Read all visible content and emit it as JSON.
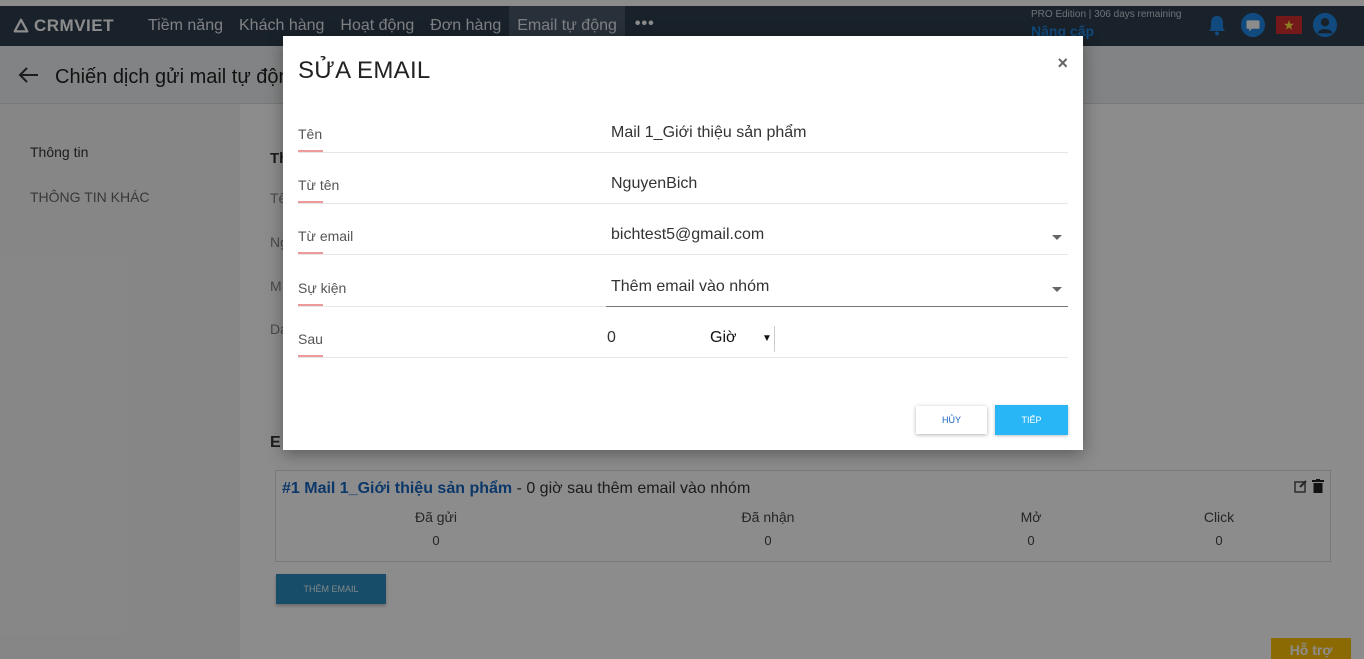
{
  "app": {
    "logo": "CRMVIET",
    "nav": [
      "Tiềm năng",
      "Khách hàng",
      "Hoạt động",
      "Đơn hàng",
      "Email tự động"
    ],
    "nav_more": "•••",
    "edition": "PRO Edition | 306 days remaining",
    "upgrade": "Nâng cấp"
  },
  "header": {
    "title": "Chiến dịch gửi mail tự động"
  },
  "sidebar": {
    "items": [
      "Thông tin",
      "THÔNG TIN KHÁC"
    ]
  },
  "main": {
    "peek_letters": [
      "Th",
      "Tê",
      "Ng",
      "M",
      "Da"
    ],
    "section_peek": "E",
    "mail_card": {
      "link": "#1 Mail 1_Giới thiệu sản phẩm",
      "suffix": " - 0 giờ sau thêm email vào nhóm",
      "stats": [
        {
          "label": "Đã gửi",
          "value": "0"
        },
        {
          "label": "Đã nhận",
          "value": "0"
        },
        {
          "label": "Mở",
          "value": "0"
        },
        {
          "label": "Click",
          "value": "0"
        }
      ]
    },
    "add_email_button": "THÊM EMAIL",
    "support_button": "Hỗ trợ"
  },
  "modal": {
    "title": "SỬA EMAIL",
    "close": "×",
    "fields": {
      "name": {
        "label": "Tên",
        "value": "Mail 1_Giới thiệu sản phẩm"
      },
      "from_name": {
        "label": "Từ tên",
        "value": "NguyenBich"
      },
      "from_email": {
        "label": "Từ email",
        "value": "bichtest5@gmail.com"
      },
      "event": {
        "label": "Sự kiện",
        "value": "Thêm email vào nhóm"
      },
      "after": {
        "label": "Sau",
        "number": "0",
        "unit": "Giờ"
      }
    },
    "cancel_label": "HỦY",
    "next_label": "TIẾP"
  },
  "colors": {
    "navbar": "#2f3e4e",
    "accent": "#29b6f6",
    "link": "#1565c0",
    "support": "#ffc107"
  }
}
